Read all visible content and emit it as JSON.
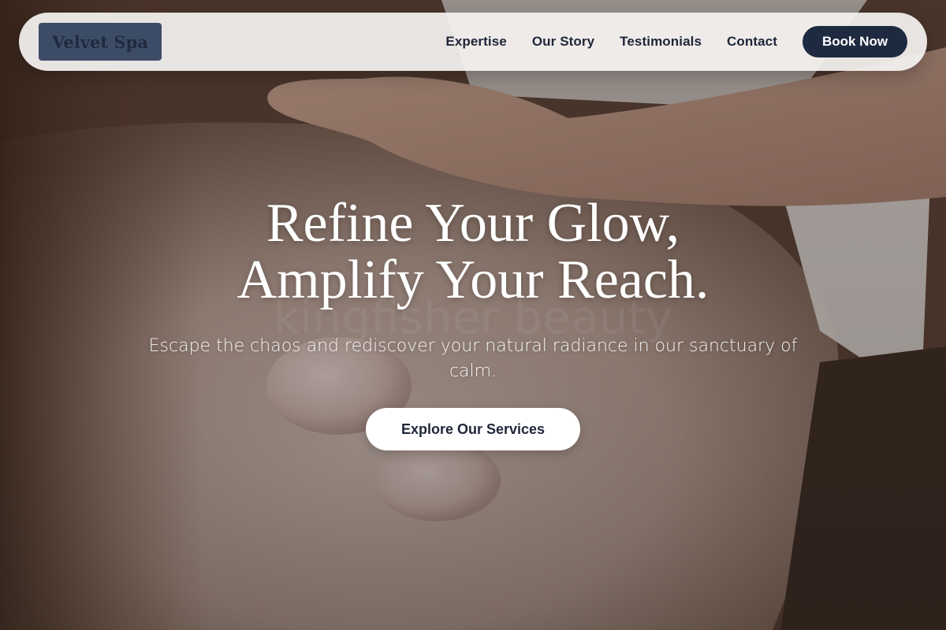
{
  "brand": {
    "name": "Velvet Spa"
  },
  "nav": {
    "links": [
      "Expertise",
      "Our Story",
      "Testimonials",
      "Contact"
    ],
    "cta_label": "Book Now"
  },
  "hero": {
    "headline_line1": "Refine Your Glow,",
    "headline_line2": "Amplify Your Reach.",
    "subtext": "Escape the chaos and rediscover your natural radiance in our sanctuary of calm.",
    "cta_label": "Explore Our Services",
    "background_image": "spa-massage-stones-photo"
  },
  "colors": {
    "navy": "#1e2a40",
    "logo_bg": "#3d4c66",
    "nav_bg": "#f4f2f0",
    "white": "#ffffff"
  }
}
